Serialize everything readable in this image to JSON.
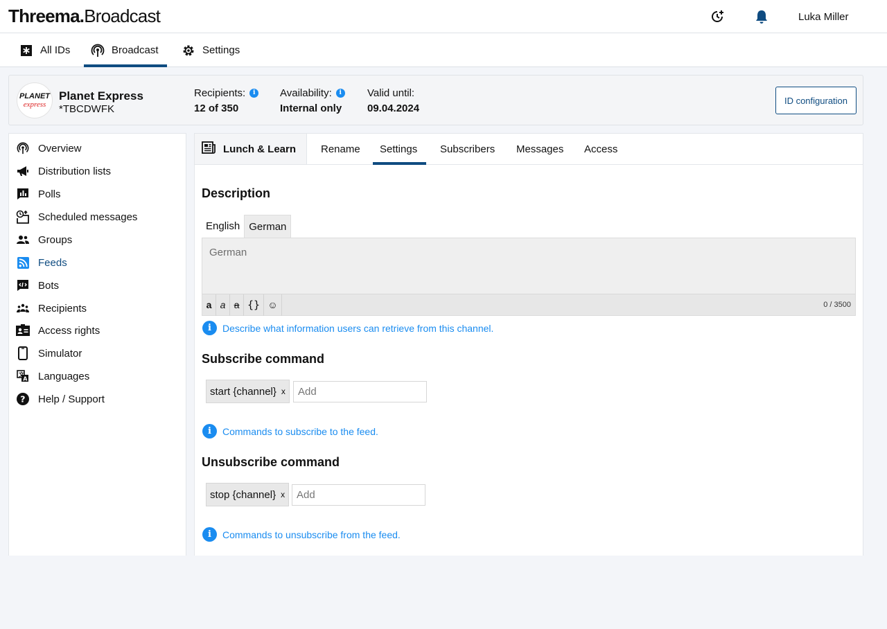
{
  "header": {
    "logo_bold": "Threema.",
    "logo_light": "Broadcast",
    "user_name": "Luka Miller",
    "icons": [
      "schedule-add-icon",
      "bell-icon"
    ]
  },
  "main_nav": [
    {
      "label": "All IDs",
      "icon": "asterisk-box-icon",
      "active": false
    },
    {
      "label": "Broadcast",
      "icon": "broadcast-icon",
      "active": true
    },
    {
      "label": "Settings",
      "icon": "gear-icon",
      "active": false
    }
  ],
  "id_card": {
    "avatar_line1": "PLANET",
    "avatar_line2": "express",
    "name": "Planet Express",
    "id": "*TBCDWFK",
    "recipients_label": "Recipients:",
    "recipients_value": "12 of 350",
    "availability_label": "Availability:",
    "availability_value": "Internal only",
    "valid_label": "Valid until:",
    "valid_value": "09.04.2024",
    "config_button": "ID configuration"
  },
  "sidebar": [
    {
      "label": "Overview",
      "icon": "broadcast-icon"
    },
    {
      "label": "Distribution lists",
      "icon": "megaphone-icon"
    },
    {
      "label": "Polls",
      "icon": "poll-icon"
    },
    {
      "label": "Scheduled messages",
      "icon": "scheduled-message-icon"
    },
    {
      "label": "Groups",
      "icon": "group-icon"
    },
    {
      "label": "Feeds",
      "icon": "rss-icon",
      "active": true
    },
    {
      "label": "Bots",
      "icon": "bot-icon"
    },
    {
      "label": "Recipients",
      "icon": "recipients-icon"
    },
    {
      "label": "Access rights",
      "icon": "id-card-icon"
    },
    {
      "label": "Simulator",
      "icon": "phone-icon"
    },
    {
      "label": "Languages",
      "icon": "translate-icon"
    },
    {
      "label": "Help / Support",
      "icon": "help-icon"
    }
  ],
  "content": {
    "feed_title": "Lunch & Learn",
    "tabs": [
      "Rename",
      "Settings",
      "Subscribers",
      "Messages",
      "Access"
    ],
    "active_tab": "Settings",
    "description": {
      "heading": "Description",
      "lang_tabs": [
        "English",
        "German"
      ],
      "active_lang": "German",
      "placeholder": "German",
      "toolbar": [
        "a",
        "a",
        "a",
        "{}",
        "☺"
      ],
      "counter": "0 / 3500",
      "hint": "Describe what information users can retrieve from this channel."
    },
    "subscribe": {
      "heading": "Subscribe command",
      "chips": [
        "start {channel}"
      ],
      "chip_remove": "x",
      "input_placeholder": "Add",
      "hint": "Commands to subscribe to the feed."
    },
    "unsubscribe": {
      "heading": "Unsubscribe command",
      "chips": [
        "stop {channel}"
      ],
      "chip_remove": "x",
      "input_placeholder": "Add",
      "hint": "Commands to unsubscribe from the feed."
    }
  },
  "colors": {
    "accent": "#0f4c81",
    "info": "#1a8cf0",
    "page_bg": "#f3f5f9"
  }
}
